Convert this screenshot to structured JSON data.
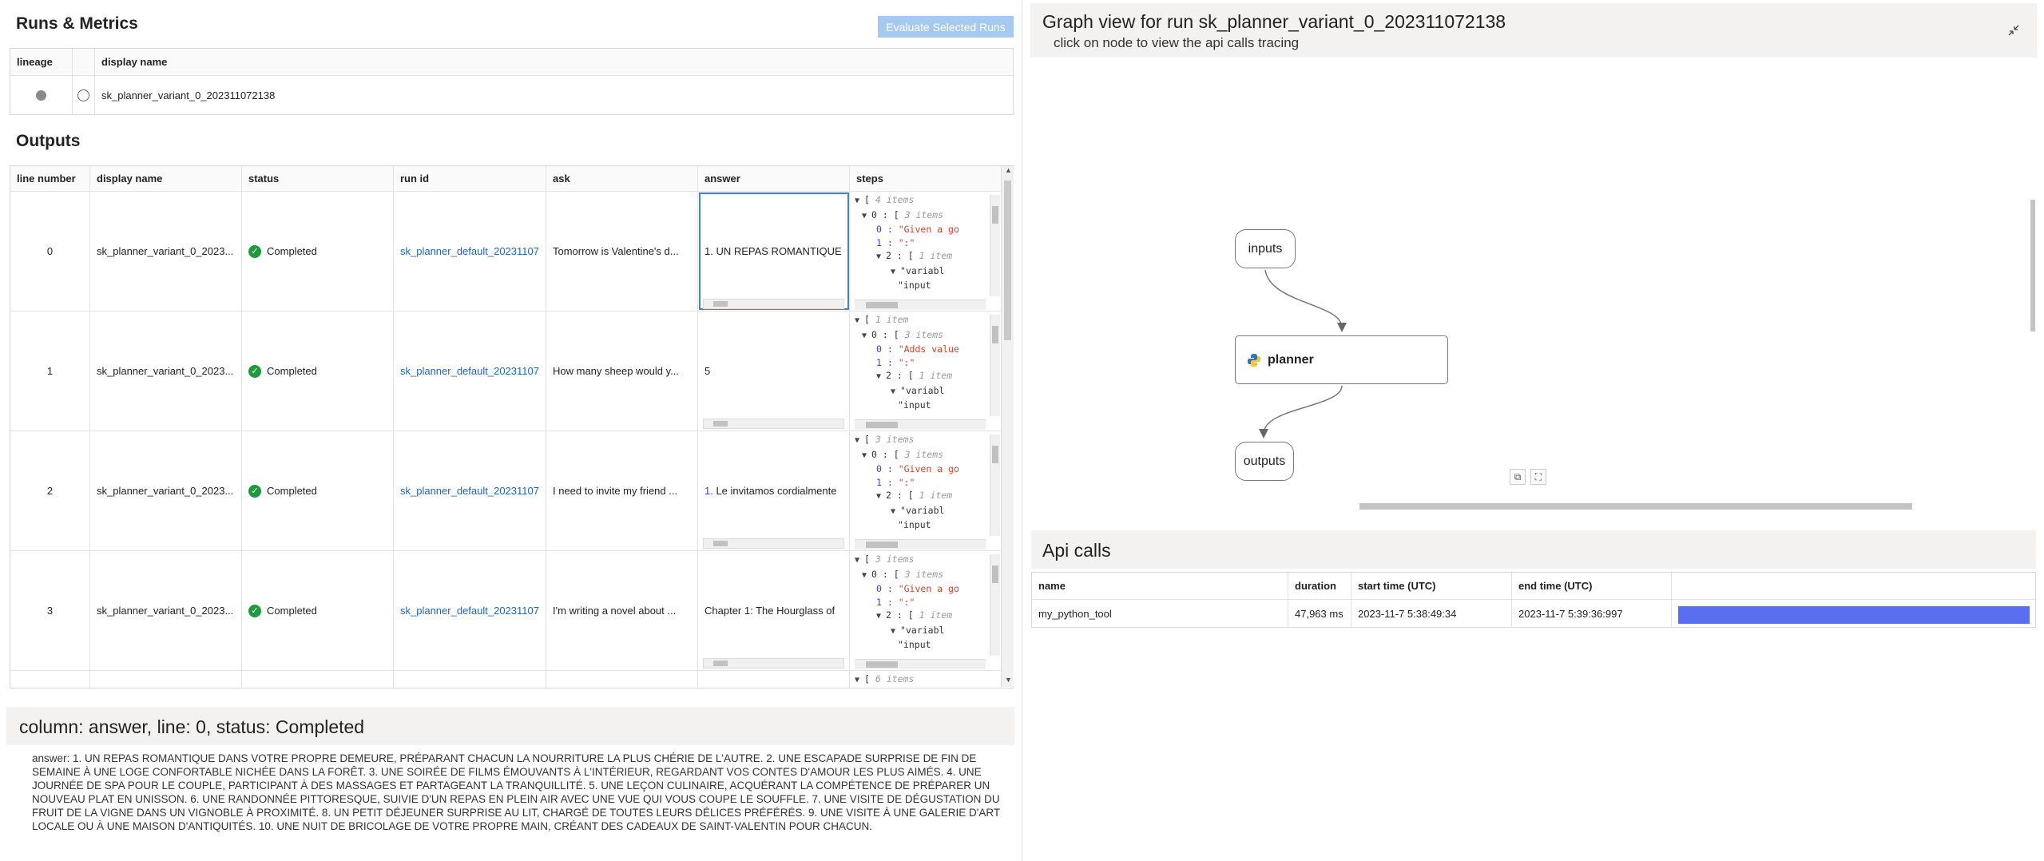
{
  "runs": {
    "title": "Runs & Metrics",
    "evaluate_button": "Evaluate Selected Runs",
    "columns": [
      "lineage",
      "",
      "display name"
    ],
    "rows": [
      {
        "display_name": "sk_planner_variant_0_202311072138"
      }
    ]
  },
  "outputs": {
    "title": "Outputs",
    "columns": [
      "line number",
      "display name",
      "status",
      "run id",
      "ask",
      "answer",
      "steps"
    ],
    "rows": [
      {
        "line": "0",
        "display_name": "sk_planner_variant_0_2023...",
        "status": "Completed",
        "run_id": "sk_planner_default_20231107",
        "ask": "Tomorrow is Valentine's d...",
        "answer": "1. UN REPAS ROMANTIQUE",
        "steps": [
          {
            "t": "arrow",
            "text": "[ ",
            "meta": "4 items",
            "indent": 0
          },
          {
            "t": "arrow",
            "text": "0 : [ ",
            "meta": "3 items",
            "indent": 1
          },
          {
            "t": "kv",
            "key": "0 : ",
            "val": "\"Given a go",
            "indent": 3
          },
          {
            "t": "kv",
            "key": "1 : ",
            "val": "\":\"",
            "indent": 3
          },
          {
            "t": "arrow",
            "text": "2 : [ ",
            "meta": "1 item",
            "indent": 3
          },
          {
            "t": "arrow",
            "text": "\"variabl",
            "meta": "",
            "indent": 5
          },
          {
            "t": "plain",
            "text": "\"input",
            "indent": 6
          }
        ]
      },
      {
        "line": "1",
        "display_name": "sk_planner_variant_0_2023...",
        "status": "Completed",
        "run_id": "sk_planner_default_20231107",
        "ask": "How many sheep would y...",
        "answer": "5",
        "steps": [
          {
            "t": "arrow",
            "text": "[ ",
            "meta": "1 item",
            "indent": 0
          },
          {
            "t": "arrow",
            "text": "0 : [ ",
            "meta": "3 items",
            "indent": 1
          },
          {
            "t": "kv",
            "key": "0 : ",
            "val": "\"Adds value",
            "indent": 3
          },
          {
            "t": "kv",
            "key": "1 : ",
            "val": "\":\"",
            "indent": 3
          },
          {
            "t": "arrow",
            "text": "2 : [ ",
            "meta": "1 item",
            "indent": 3
          },
          {
            "t": "arrow",
            "text": "\"variabl",
            "meta": "",
            "indent": 5
          },
          {
            "t": "plain",
            "text": "\"input",
            "indent": 6
          }
        ]
      },
      {
        "line": "2",
        "display_name": "sk_planner_variant_0_2023...",
        "status": "Completed",
        "run_id": "sk_planner_default_20231107",
        "ask": "I need to invite my friend ...",
        "answer_num": "1.",
        "answer": " Le invitamos cordialmente",
        "steps": [
          {
            "t": "arrow",
            "text": "[ ",
            "meta": "3 items",
            "indent": 0
          },
          {
            "t": "arrow",
            "text": "0 : [ ",
            "meta": "3 items",
            "indent": 1
          },
          {
            "t": "kv",
            "key": "0 : ",
            "val": "\"Given a go",
            "indent": 3
          },
          {
            "t": "kv",
            "key": "1 : ",
            "val": "\":\"",
            "indent": 3
          },
          {
            "t": "arrow",
            "text": "2 : [ ",
            "meta": "1 item",
            "indent": 3
          },
          {
            "t": "arrow",
            "text": "\"variabl",
            "meta": "",
            "indent": 5
          },
          {
            "t": "plain",
            "text": "\"input",
            "indent": 6
          }
        ]
      },
      {
        "line": "3",
        "display_name": "sk_planner_variant_0_2023...",
        "status": "Completed",
        "run_id": "sk_planner_default_20231107",
        "ask": "I'm writing a novel about ...",
        "answer": "Chapter 1: The Hourglass of",
        "steps": [
          {
            "t": "arrow",
            "text": "[ ",
            "meta": "3 items",
            "indent": 0
          },
          {
            "t": "arrow",
            "text": "0 : [ ",
            "meta": "3 items",
            "indent": 1
          },
          {
            "t": "kv",
            "key": "0 : ",
            "val": "\"Given a go",
            "indent": 3
          },
          {
            "t": "kv",
            "key": "1 : ",
            "val": "\":\"",
            "indent": 3
          },
          {
            "t": "arrow",
            "text": "2 : [ ",
            "meta": "1 item",
            "indent": 3
          },
          {
            "t": "arrow",
            "text": "\"variabl",
            "meta": "",
            "indent": 5
          },
          {
            "t": "plain",
            "text": "\"input",
            "indent": 6
          }
        ]
      },
      {
        "line": "",
        "display_name": "",
        "status": "",
        "run_id": "",
        "ask": "",
        "answer": "",
        "steps": [
          {
            "t": "arrow",
            "text": "[ ",
            "meta": "6 items",
            "indent": 0
          }
        ]
      }
    ]
  },
  "detail": {
    "title": "column: answer, line: 0, status: Completed",
    "body": "answer: 1. UN REPAS ROMANTIQUE DANS VOTRE PROPRE DEMEURE, PRÉPARANT CHACUN LA NOURRITURE LA PLUS CHÉRIE DE L'AUTRE. 2. UNE ESCAPADE SURPRISE DE FIN DE SEMAINE À UNE LOGE CONFORTABLE NICHÉE DANS LA FORÊT. 3. UNE SOIRÉE DE FILMS ÉMOUVANTS À L'INTÉRIEUR, REGARDANT VOS CONTES D'AMOUR LES PLUS AIMÉS. 4. UNE JOURNÉE DE SPA POUR LE COUPLE, PARTICIPANT À DES MASSAGES ET PARTAGEANT LA TRANQUILLITÉ. 5. UNE LEÇON CULINAIRE, ACQUÉRANT LA COMPÉTENCE DE PRÉPARER UN NOUVEAU PLAT EN UNISSON. 6. UNE RANDONNÉE PITTORESQUE, SUIVIE D'UN REPAS EN PLEIN AIR AVEC UNE VUE QUI VOUS COUPE LE SOUFFLE. 7. UNE VISITE DE DÉGUSTATION DU FRUIT DE LA VIGNE DANS UN VIGNOBLE À PROXIMITÉ. 8. UN PETIT DÉJEUNER SURPRISE AU LIT, CHARGÉ DE TOUTES LEURS DÉLICES PRÉFÉRÉS. 9. UNE VISITE À UNE GALERIE D'ART LOCALE OU À UNE MAISON D'ANTIQUITÉS. 10. UNE NUIT DE BRICOLAGE DE VOTRE PROPRE MAIN, CRÉANT DES CADEAUX DE SAINT-VALENTIN POUR CHACUN."
  },
  "graph": {
    "title": "Graph view for run sk_planner_variant_0_202311072138",
    "subtitle": "click on node to view the api calls tracing",
    "nodes": {
      "inputs": "inputs",
      "planner": "planner",
      "outputs": "outputs"
    }
  },
  "api": {
    "title": "Api calls",
    "columns": [
      "name",
      "duration",
      "start time (UTC)",
      "end time (UTC)"
    ],
    "rows": [
      {
        "name": "my_python_tool",
        "duration": "47,963 ms",
        "start": "2023-11-7 5:38:49:34",
        "end": "2023-11-7 5:39:36:997",
        "bar_fraction": 1.0
      }
    ]
  },
  "colors": {
    "accent": "#5a6ff0",
    "status_ok": "#1e9b3d",
    "link": "#2266b8",
    "button_disabled": "#a6c9ef"
  }
}
